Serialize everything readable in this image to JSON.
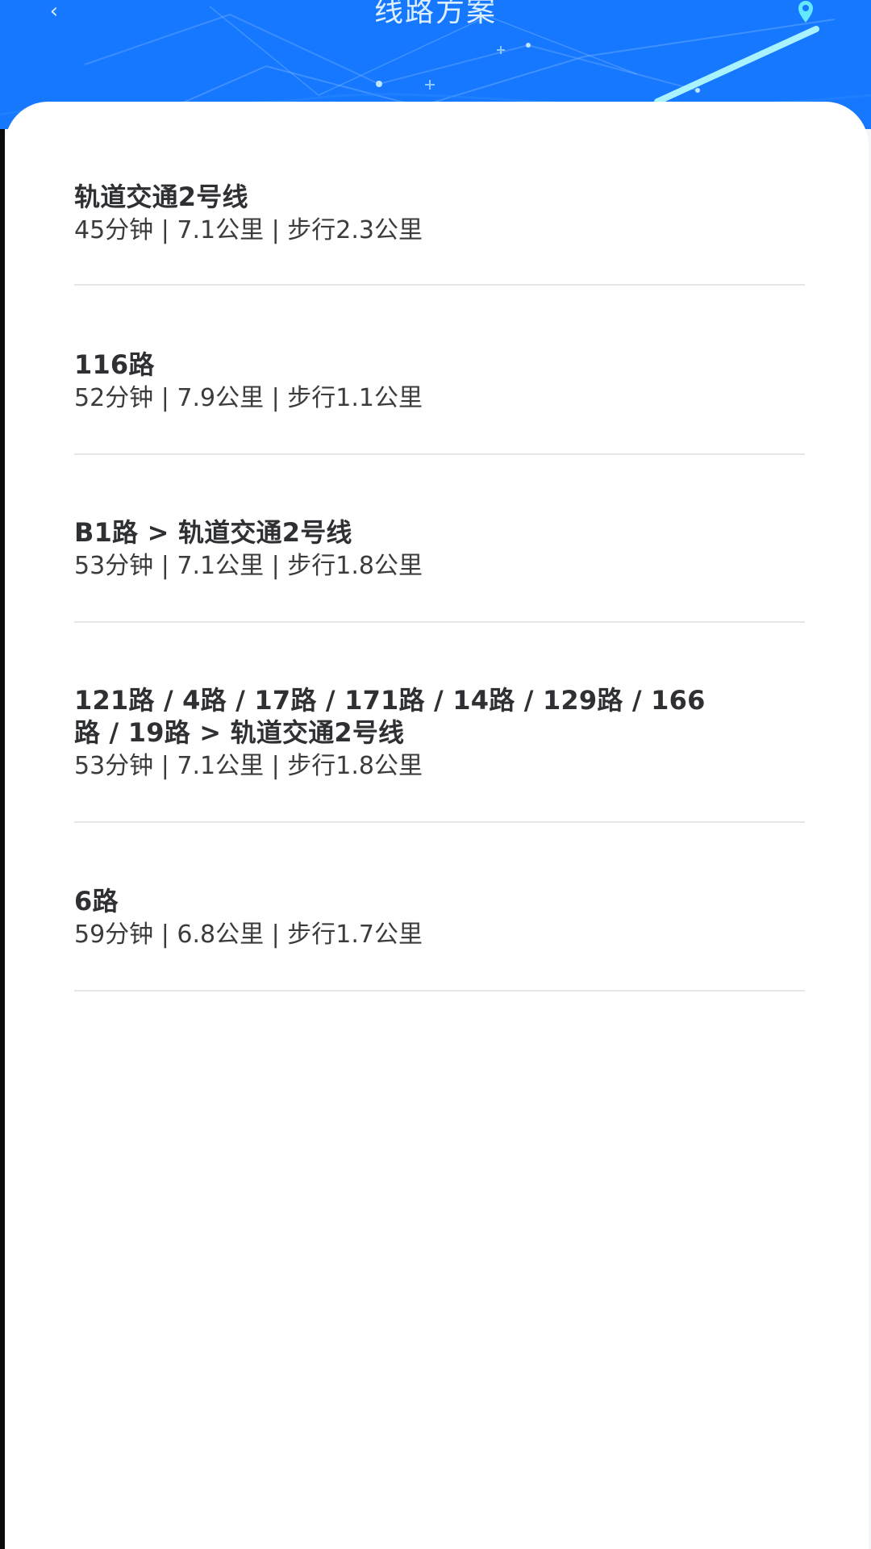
{
  "header": {
    "title": "线路方案",
    "back_symbol": "‹",
    "back_icon": "chevron-left-icon",
    "location_icon": "location-pin-icon",
    "brand_color": "#1677ff"
  },
  "routes": [
    {
      "title": "轨道交通2号线",
      "meta": "45分钟 | 7.1公里 | 步行2.3公里"
    },
    {
      "title": "116路",
      "meta": "52分钟 | 7.9公里 | 步行1.1公里"
    },
    {
      "title": "B1路 > 轨道交通2号线",
      "meta": "53分钟 | 7.1公里 | 步行1.8公里"
    },
    {
      "title": "121路 / 4路 / 17路 / 171路 / 14路 / 129路 / 166路 / 19路 > 轨道交通2号线",
      "meta": "53分钟 | 7.1公里 | 步行1.8公里"
    },
    {
      "title": "6路",
      "meta": "59分钟 | 6.8公里 | 步行1.7公里"
    }
  ]
}
